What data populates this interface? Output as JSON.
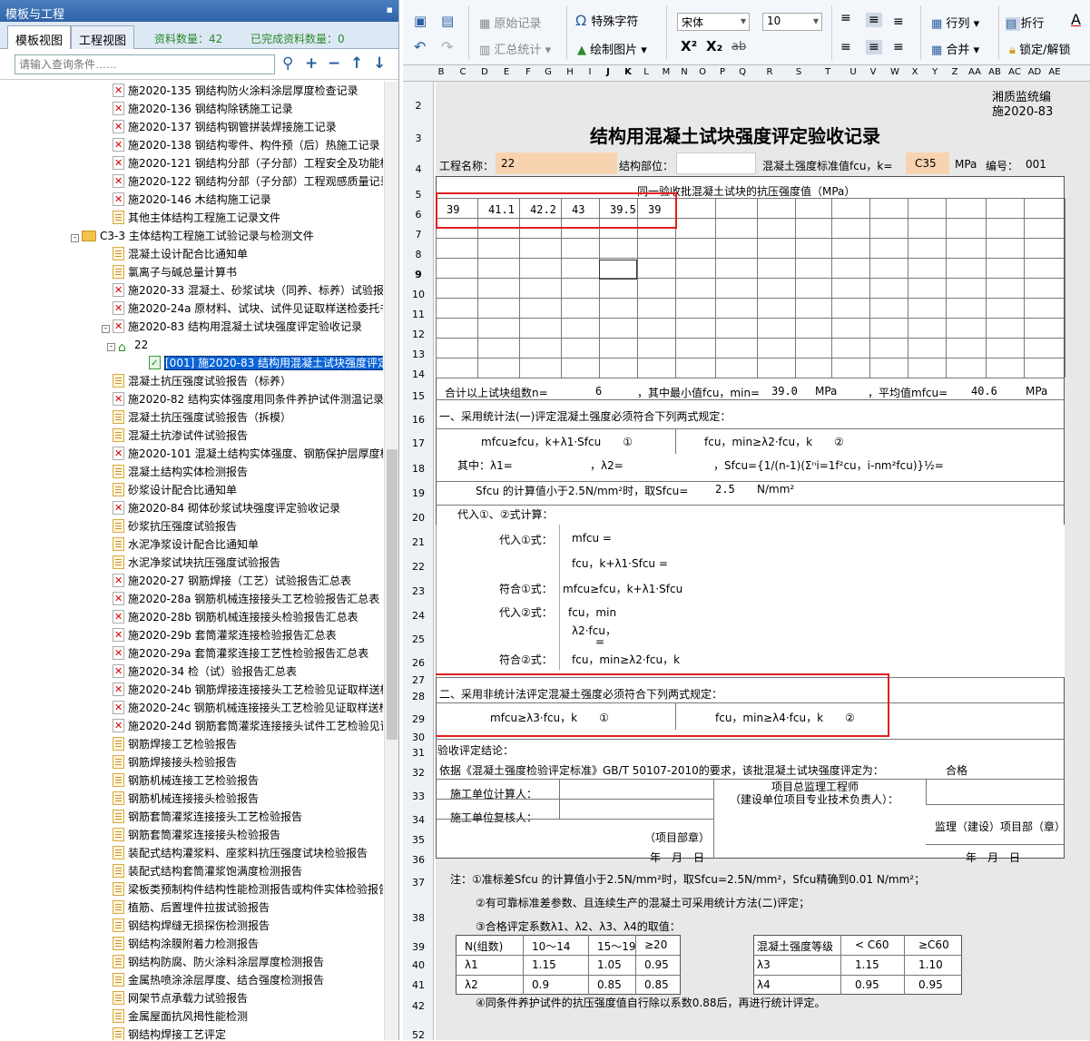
{
  "left_panel": {
    "title": "模板与工程",
    "pin_icon": "pin-icon",
    "tabs": [
      "模板视图",
      "工程视图"
    ],
    "stats": {
      "count_label": "资料数量：42",
      "done_label": "已完成资料数量：0"
    },
    "search_placeholder": "请输入查询条件……",
    "tree": [
      {
        "t": "施2020-135 钢结构防火涂料涂层厚度检查记录",
        "i": "pdf",
        "l": 2
      },
      {
        "t": "施2020-136 钢结构除锈施工记录",
        "i": "pdf",
        "l": 2
      },
      {
        "t": "施2020-137 钢结构钢管拼装焊接施工记录",
        "i": "pdf",
        "l": 2
      },
      {
        "t": "施2020-138 钢结构零件、构件预（后）热施工记录",
        "i": "pdf",
        "l": 2
      },
      {
        "t": "施2020-121 钢结构分部（子分部）工程安全及功能检",
        "i": "pdf",
        "l": 2
      },
      {
        "t": "施2020-122 钢结构分部（子分部）工程观感质量记录",
        "i": "pdf",
        "l": 2
      },
      {
        "t": "施2020-146 木结构施工记录",
        "i": "pdf",
        "l": 2
      },
      {
        "t": "其他主体结构工程施工记录文件",
        "i": "doc",
        "l": 2
      },
      {
        "t": "C3-3 主体结构工程施工试验记录与检测文件",
        "i": "folder",
        "l": 1,
        "exp": "-"
      },
      {
        "t": "混凝土设计配合比通知单",
        "i": "doc",
        "l": 2
      },
      {
        "t": "氯离子与碱总量计算书",
        "i": "doc",
        "l": 2
      },
      {
        "t": "施2020-33 混凝土、砂浆试块（同养、标养）试验报告",
        "i": "pdf",
        "l": 2
      },
      {
        "t": "施2020-24a 原材料、试块、试件见证取样送检委托书",
        "i": "pdf",
        "l": 2
      },
      {
        "t": "施2020-83 结构用混凝土试块强度评定验收记录",
        "i": "pdf",
        "l": 2,
        "exp": "-"
      },
      {
        "t": "22",
        "i": "home",
        "l": 3,
        "exp": "-"
      },
      {
        "t": "[001] 施2020-83 结构用混凝土试块强度评定",
        "i": "sheet",
        "l": 4,
        "sel": true
      },
      {
        "t": "混凝土抗压强度试验报告（标养）",
        "i": "doc",
        "l": 2
      },
      {
        "t": "施2020-82 结构实体强度用同条件养护试件测温记录",
        "i": "pdf",
        "l": 2
      },
      {
        "t": "混凝土抗压强度试验报告（拆模）",
        "i": "doc",
        "l": 2
      },
      {
        "t": "混凝土抗渗试件试验报告",
        "i": "doc",
        "l": 2
      },
      {
        "t": "施2020-101 混凝土结构实体强度、钢筋保护层厚度检",
        "i": "pdf",
        "l": 2
      },
      {
        "t": "混凝土结构实体检测报告",
        "i": "doc",
        "l": 2
      },
      {
        "t": "砂浆设计配合比通知单",
        "i": "doc",
        "l": 2
      },
      {
        "t": "施2020-84 砌体砂浆试块强度评定验收记录",
        "i": "pdf",
        "l": 2
      },
      {
        "t": "砂浆抗压强度试验报告",
        "i": "doc",
        "l": 2
      },
      {
        "t": "水泥净浆设计配合比通知单",
        "i": "doc",
        "l": 2
      },
      {
        "t": "水泥净浆试块抗压强度试验报告",
        "i": "doc",
        "l": 2
      },
      {
        "t": "施2020-27 钢筋焊接（工艺）试验报告汇总表",
        "i": "pdf",
        "l": 2
      },
      {
        "t": "施2020-28a 钢筋机械连接接头工艺检验报告汇总表",
        "i": "pdf",
        "l": 2
      },
      {
        "t": "施2020-28b 钢筋机械连接接头检验报告汇总表",
        "i": "pdf",
        "l": 2
      },
      {
        "t": "施2020-29b 套筒灌浆连接检验报告汇总表",
        "i": "pdf",
        "l": 2
      },
      {
        "t": "施2020-29a 套筒灌浆连接工艺性检验报告汇总表",
        "i": "pdf",
        "l": 2
      },
      {
        "t": "施2020-34 检（试）验报告汇总表",
        "i": "pdf",
        "l": 2
      },
      {
        "t": "施2020-24b 钢筋焊接连接接头工艺检验见证取样送检",
        "i": "pdf",
        "l": 2
      },
      {
        "t": "施2020-24c 钢筋机械连接接头工艺检验见证取样送检",
        "i": "pdf",
        "l": 2
      },
      {
        "t": "施2020-24d 钢筋套筒灌浆连接接头试件工艺检验见证",
        "i": "pdf",
        "l": 2
      },
      {
        "t": "钢筋焊接工艺检验报告",
        "i": "doc",
        "l": 2
      },
      {
        "t": "钢筋焊接接头检验报告",
        "i": "doc",
        "l": 2
      },
      {
        "t": "钢筋机械连接工艺检验报告",
        "i": "doc",
        "l": 2
      },
      {
        "t": "钢筋机械连接接头检验报告",
        "i": "doc",
        "l": 2
      },
      {
        "t": "钢筋套筒灌浆连接接头工艺检验报告",
        "i": "doc",
        "l": 2
      },
      {
        "t": "钢筋套筒灌浆连接接头检验报告",
        "i": "doc",
        "l": 2
      },
      {
        "t": "装配式结构灌浆料、座浆料抗压强度试块检验报告",
        "i": "doc",
        "l": 2
      },
      {
        "t": "装配式结构套筒灌浆饱满度检测报告",
        "i": "doc",
        "l": 2
      },
      {
        "t": "梁板类预制构件结构性能检测报告或构件实体检验报告",
        "i": "doc",
        "l": 2
      },
      {
        "t": "植筋、后置埋件拉拔试验报告",
        "i": "doc",
        "l": 2
      },
      {
        "t": "钢结构焊缝无损探伤检测报告",
        "i": "doc",
        "l": 2
      },
      {
        "t": "钢结构涂膜附着力检测报告",
        "i": "doc",
        "l": 2
      },
      {
        "t": "钢结构防腐、防火涂料涂层厚度检测报告",
        "i": "doc",
        "l": 2
      },
      {
        "t": "金属热喷涂涂层厚度、结合强度检测报告",
        "i": "doc",
        "l": 2
      },
      {
        "t": "网架节点承载力试验报告",
        "i": "doc",
        "l": 2
      },
      {
        "t": "金属屋面抗风揭性能检测",
        "i": "doc",
        "l": 2
      },
      {
        "t": "钢结构焊接工艺评定",
        "i": "doc",
        "l": 2
      }
    ]
  },
  "toolbar": {
    "row1": [
      "原始记录",
      "特殊字符",
      "宋体",
      "10",
      "行列",
      "折行"
    ],
    "row2": [
      "汇总统计",
      "绘制图片",
      "合并",
      "锁定/解锁"
    ],
    "superscript": "X²",
    "subscript": "X₂",
    "strike": "ab"
  },
  "columns": [
    "B",
    "C",
    "D",
    "E",
    "F",
    "G",
    "H",
    "I",
    "J",
    "K",
    "L",
    "M",
    "N",
    "O",
    "P",
    "Q",
    "R",
    "S",
    "T",
    "U",
    "V",
    "W",
    "X",
    "Y",
    "Z",
    "AA",
    "AB",
    "AC",
    "AD",
    "AE"
  ],
  "rows": [
    "2",
    "3",
    "4",
    "5",
    "6",
    "7",
    "8",
    "9",
    "10",
    "11",
    "12",
    "13",
    "14",
    "15",
    "16",
    "17",
    "18",
    "19",
    "20",
    "21",
    "22",
    "23",
    "24",
    "25",
    "26",
    "27",
    "28",
    "29",
    "30",
    "31",
    "32",
    "33",
    "34",
    "35",
    "36",
    "37",
    "38",
    "39",
    "40",
    "41",
    "42",
    "52"
  ],
  "form": {
    "org": "湘质监统编",
    "code": "施2020-83",
    "title": "结构用混凝土试块强度评定验收记录",
    "project_label": "工程名称：",
    "project_value": "22",
    "part_label": "结构部位：",
    "grade_label": "混凝土强度标准值fcu，k=",
    "grade_value": "C35",
    "mpa": "MPa",
    "no_label": "编号：",
    "no_value": "001",
    "batch_header": "同一验收批混凝土试块的抗压强度值（MPa）",
    "strengths": [
      "39",
      "41.1",
      "42.2",
      "43",
      "39.5",
      "39"
    ],
    "r15": {
      "a": "合计以上试块组数n=",
      "n": "6",
      "b": "，其中最小值fcu，min=",
      "min": "39.0",
      "mpa": "MPa",
      "c": "，平均值mfcu=",
      "avg": "40.6",
      "mpa2": "MPa"
    },
    "s1_title": "一、采用统计法(一)评定混凝土强度必须符合下列两式规定：",
    "f17a": "mfcu≥fcu，k+λ1·Sfcu　　①",
    "f17b": "fcu，min≥λ2·fcu，k　　②",
    "f18a": "其中：λ1=",
    "f18b": "，λ2=",
    "f18c": "，Sfcu={1/(n-1)(Σⁿi=1f²cu，i-nm²fcu)}½=",
    "f19a": "Sfcu 的计算值小于2.5N/mm²时，取Sfcu=",
    "f19b": "2.5",
    "f19c": "N/mm²",
    "f20": "代入①、②式计算：",
    "f21a": "代入①式：",
    "f21b": "mfcu =",
    "f22": "fcu，k+λ1·Sfcu =",
    "f23a": "符合①式：",
    "f23b": "mfcu≥fcu，k+λ1·Sfcu",
    "f24a": "代入②式：",
    "f24b": "fcu，min",
    "f25a": "λ2·fcu，",
    "f25b": "=",
    "f26a": "符合②式：",
    "f26b": "fcu，min≥λ2·fcu，k",
    "s2_title": "二、采用非统计法评定混凝土强度必须符合下列两式规定：",
    "f29a": "mfcu≥λ3·fcu，k　　①",
    "f29b": "fcu，min≥λ4·fcu，k　　②",
    "f31": "验收评定结论：",
    "f32a": "依据《混凝土强度检验评定标准》GB/T 50107-2010的要求，该批混凝土试块强度评定为：",
    "f32b": "合格",
    "f33a": "施工单位计算人：",
    "f33b": "项目总监理工程师",
    "f33c": "（建设单位项目专业技术负责人）：",
    "f34": "施工单位复核人：",
    "f35a": "（项目部章）",
    "f35b": "监理（建设）项目部（章）",
    "date": "年　月　日",
    "n37": "注：①准标差Sfcu 的计算值小于2.5N/mm²时，取Sfcu=2.5N/mm²，Sfcu精确到0.01 N/mm²；",
    "n38": "②有可靠标准差参数、且连续生产的混凝土可采用统计方法(二)评定；",
    "n39": "③合格评定系数λ1、λ2、λ3、λ4的取值：",
    "t1_head": [
      "N(组数)",
      "10～14",
      "15～19",
      "≥20"
    ],
    "t1_r1": [
      "λ1",
      "1.15",
      "1.05",
      "0.95"
    ],
    "t1_r2": [
      "λ2",
      "0.9",
      "0.85",
      "0.85"
    ],
    "t2_head": [
      "混凝土强度等级",
      "< C60",
      "≥C60"
    ],
    "t2_r1": [
      "λ3",
      "1.15",
      "1.10"
    ],
    "t2_r2": [
      "λ4",
      "0.95",
      "0.95"
    ],
    "n42": "④同条件养护试件的抗压强度值自行除以系数0.88后，再进行统计评定。"
  },
  "colors": {
    "highlight": "#e02020",
    "input_fill": "#f8d3b0",
    "selection": "#0a64d8"
  }
}
